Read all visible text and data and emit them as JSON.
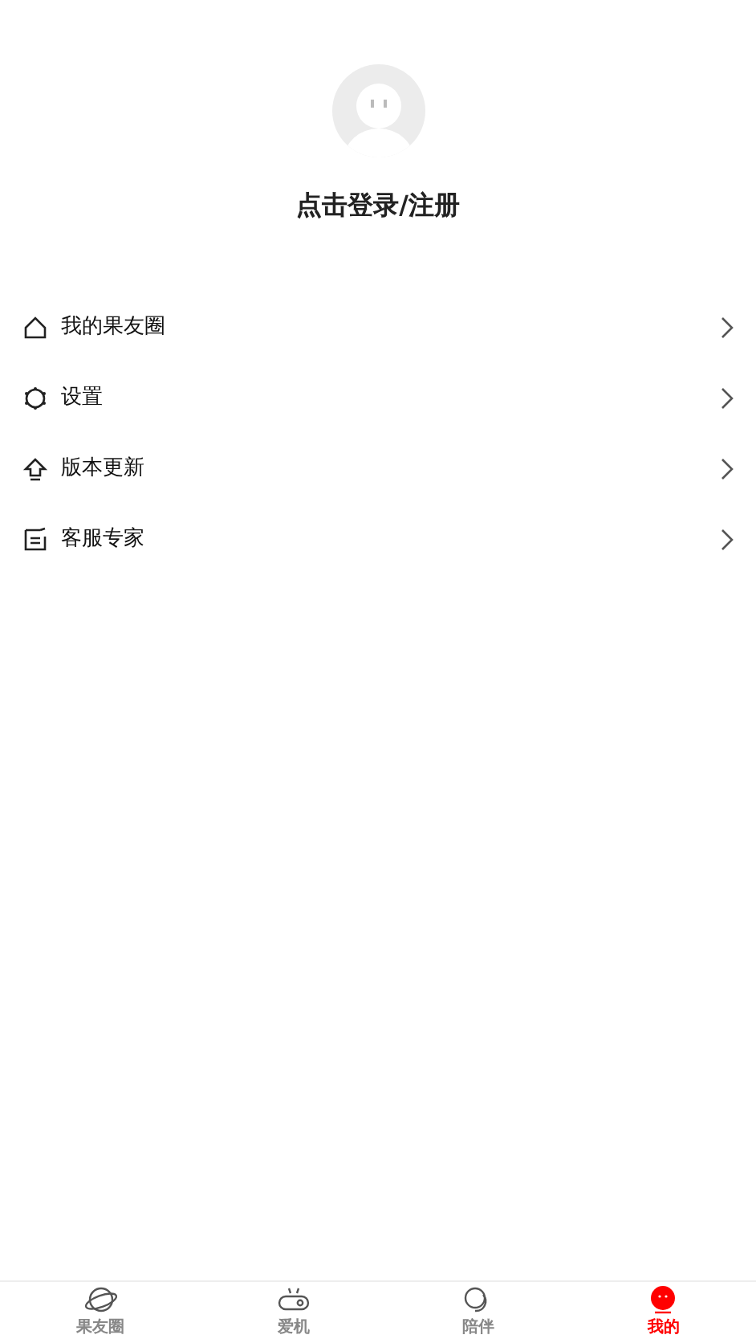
{
  "profile": {
    "login_text": "点击登录/注册"
  },
  "menu": [
    {
      "kind": "home",
      "label": "我的果友圈"
    },
    {
      "kind": "settings",
      "label": "设置"
    },
    {
      "kind": "update",
      "label": "版本更新"
    },
    {
      "kind": "service",
      "label": "客服专家"
    }
  ],
  "tabs": [
    {
      "kind": "planet",
      "label": "果友圈",
      "selected": false
    },
    {
      "kind": "device",
      "label": "爱机",
      "selected": false
    },
    {
      "kind": "chat",
      "label": "陪伴",
      "selected": false
    },
    {
      "kind": "me",
      "label": "我的",
      "selected": true
    }
  ]
}
